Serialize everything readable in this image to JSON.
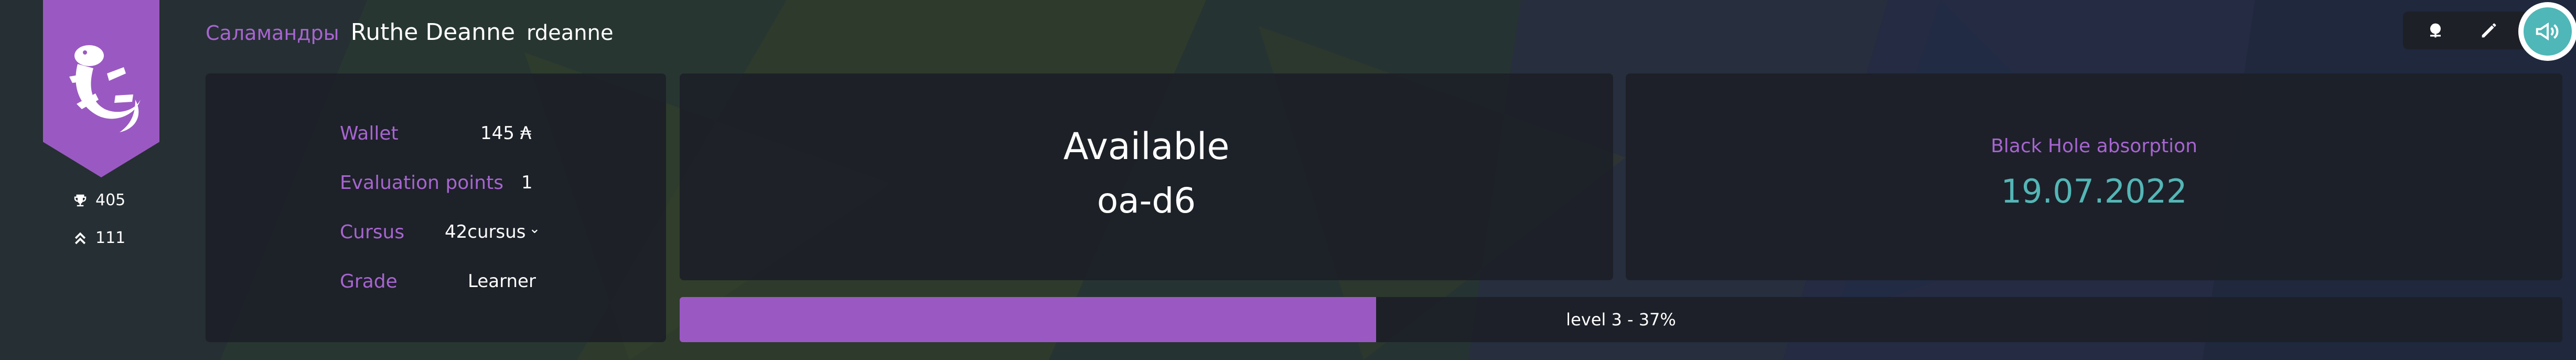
{
  "colors": {
    "accent_purple": "#9a59c2",
    "label_purple": "#a765d0",
    "teal": "#54b6b6",
    "panel_bg": "#1d2027"
  },
  "coalition": {
    "name": "Саламандры",
    "logo_icon": "salamander-icon"
  },
  "stats": {
    "trophy_icon": "trophy-icon",
    "trophy_value": "405",
    "rank_icon": "chevrons-up-icon",
    "rank_value": "111"
  },
  "user": {
    "fullname": "Ruthe Deanne",
    "login": "rdeanne"
  },
  "info": {
    "wallet_label": "Wallet",
    "wallet_value": "145 ₳",
    "eval_label": "Evaluation points",
    "eval_value": "1",
    "cursus_label": "Cursus",
    "cursus_value": "42cursus",
    "cursus_chevron": "⌄",
    "grade_label": "Grade",
    "grade_value": "Learner"
  },
  "location": {
    "status": "Available",
    "host": "oa-d6"
  },
  "blackhole": {
    "label": "Black Hole absorption",
    "date": "19.07.2022"
  },
  "level": {
    "text": "level 3 - 37%",
    "progress_percent": 37
  },
  "toolbar": {
    "globe_icon": "globe-icon",
    "edit_icon": "pencil-icon",
    "announce_icon": "megaphone-icon"
  }
}
